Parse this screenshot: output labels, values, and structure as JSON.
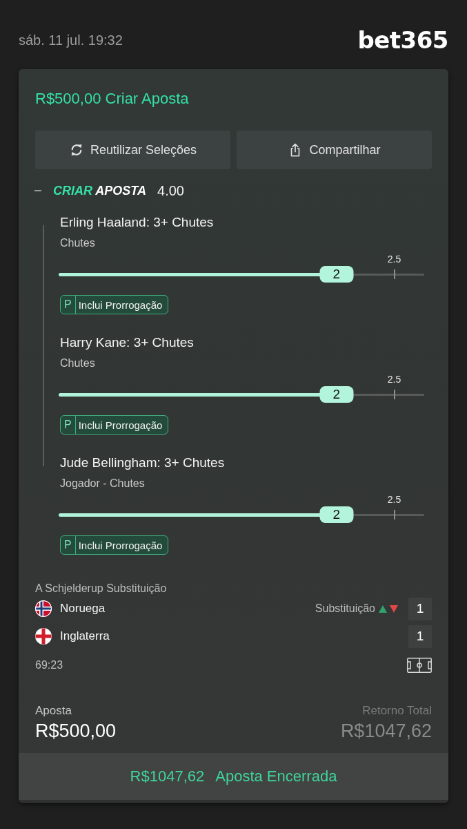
{
  "status": {
    "datetime": "sáb. 11 jul. 19:32",
    "logo": "bet365"
  },
  "bet_slip": {
    "title": "R$500,00 Criar Aposta",
    "actions": [
      {
        "kind": "reuse",
        "label": "Reutilizar Seleções"
      },
      {
        "kind": "share",
        "label": "Compartilhar"
      }
    ],
    "group": {
      "expanded": true,
      "brand_word_1": "CRIAR",
      "brand_word_2": "APOSTA",
      "odds": "4.00"
    },
    "selections": [
      {
        "title": "Erling Haaland: 3+ Chutes",
        "market": "Chutes",
        "line": "2.5",
        "current": "2",
        "level": 0.76,
        "badge_letter": "P",
        "badge_text": "Inclui Prorrogação"
      },
      {
        "title": "Harry Kane: 3+ Chutes",
        "market": "Chutes",
        "line": "2.5",
        "current": "2",
        "level": 0.76,
        "badge_letter": "P",
        "badge_text": "Inclui Prorrogação"
      },
      {
        "title": "Jude Bellingham: 3+ Chutes",
        "market": "Jogador - Chutes",
        "line": "2.5",
        "current": "2",
        "level": 0.76,
        "badge_letter": "P",
        "badge_text": "Inclui Prorrogação"
      }
    ],
    "match": {
      "event": "A Schjelderup Substituição",
      "teams": [
        {
          "kind": "norway",
          "name": "Noruega",
          "incident": "Substituição",
          "score": "1"
        },
        {
          "kind": "england",
          "name": "Inglaterra",
          "score": "1"
        }
      ],
      "clock": "69:23"
    },
    "stake": {
      "label": "Aposta",
      "value": "R$500,00"
    },
    "total_return": {
      "label": "Retorno Total",
      "value": "R$1047,62"
    },
    "cashout": {
      "amount": "R$1047,62",
      "status": "Aposta Encerrada"
    }
  }
}
